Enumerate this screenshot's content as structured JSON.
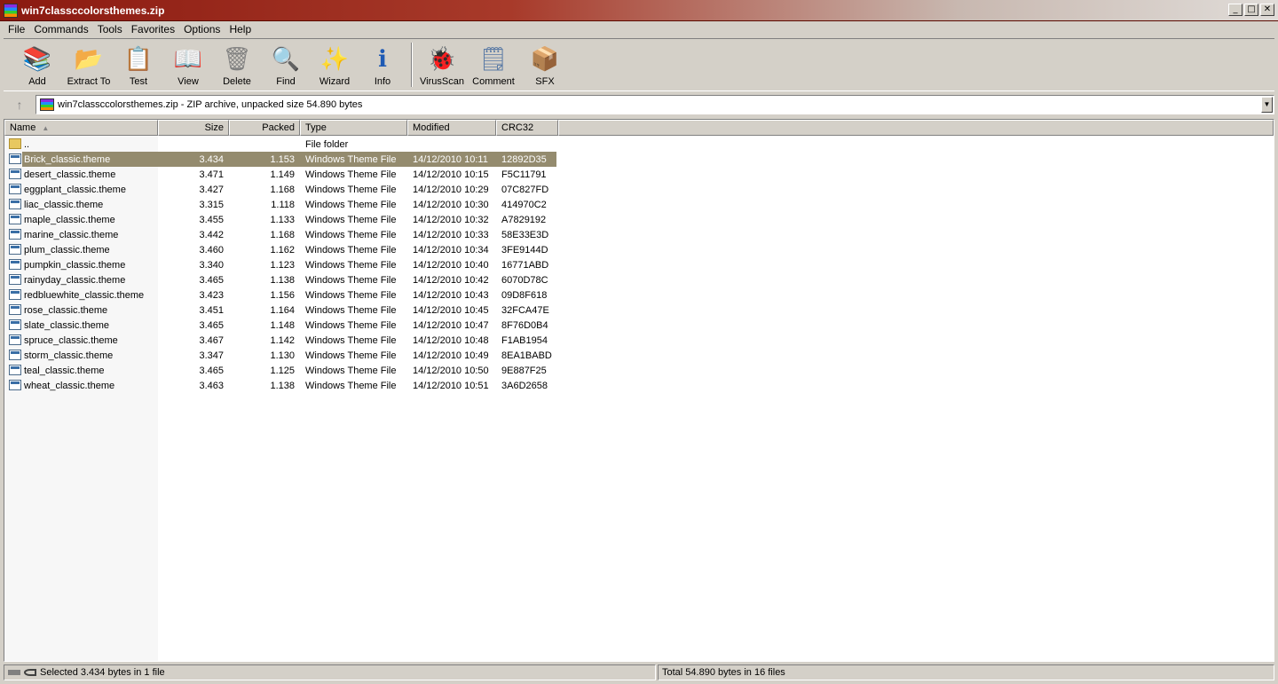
{
  "window": {
    "title": "win7classccolorsthemes.zip",
    "controls": {
      "minimize": "_",
      "maximize": "□",
      "close": "✕"
    }
  },
  "menu": [
    "File",
    "Commands",
    "Tools",
    "Favorites",
    "Options",
    "Help"
  ],
  "toolbar": {
    "buttons": [
      {
        "label": "Add",
        "icon": "add-archive-icon",
        "glyph": "📚",
        "color": "#8a2be2"
      },
      {
        "label": "Extract To",
        "icon": "extract-to-icon",
        "glyph": "📂",
        "color": "#1e90ff"
      },
      {
        "label": "Test",
        "icon": "test-icon",
        "glyph": "📋",
        "color": "#c0392b"
      },
      {
        "label": "View",
        "icon": "view-icon",
        "glyph": "📖",
        "color": "#2e8b57"
      },
      {
        "label": "Delete",
        "icon": "delete-icon",
        "glyph": "🗑",
        "color": "#808080"
      },
      {
        "label": "Find",
        "icon": "find-icon",
        "glyph": "🔍",
        "color": "#1e5ab4"
      },
      {
        "label": "Wizard",
        "icon": "wizard-icon",
        "glyph": "✨",
        "color": "#8a6d3b"
      },
      {
        "label": "Info",
        "icon": "info-icon",
        "glyph": "ℹ",
        "color": "#1e5ab4"
      },
      {
        "label": "VirusScan",
        "icon": "virus-scan-icon",
        "glyph": "🐞",
        "color": "#2eaa2e"
      },
      {
        "label": "Comment",
        "icon": "comment-icon",
        "glyph": "🗒",
        "color": "#5a7aa5"
      },
      {
        "label": "SFX",
        "icon": "sfx-icon",
        "glyph": "📦",
        "color": "#d2691e"
      }
    ]
  },
  "address": {
    "up_glyph": "↑",
    "text": "win7classccolorsthemes.zip - ZIP archive, unpacked size 54.890 bytes",
    "dropdown_glyph": "▼"
  },
  "columns": {
    "name": "Name",
    "sort_glyph": "▲",
    "size": "Size",
    "packed": "Packed",
    "type": "Type",
    "modified": "Modified",
    "crc": "CRC32"
  },
  "parent_row": {
    "name": "..",
    "type": "File folder"
  },
  "files": [
    {
      "name": "Brick_classic.theme",
      "size": "3.434",
      "packed": "1.153",
      "type": "Windows Theme File",
      "modified": "14/12/2010 10:11",
      "crc": "12892D35",
      "selected": true
    },
    {
      "name": "desert_classic.theme",
      "size": "3.471",
      "packed": "1.149",
      "type": "Windows Theme File",
      "modified": "14/12/2010 10:15",
      "crc": "F5C11791"
    },
    {
      "name": "eggplant_classic.theme",
      "size": "3.427",
      "packed": "1.168",
      "type": "Windows Theme File",
      "modified": "14/12/2010 10:29",
      "crc": "07C827FD"
    },
    {
      "name": "liac_classic.theme",
      "size": "3.315",
      "packed": "1.118",
      "type": "Windows Theme File",
      "modified": "14/12/2010 10:30",
      "crc": "414970C2"
    },
    {
      "name": "maple_classic.theme",
      "size": "3.455",
      "packed": "1.133",
      "type": "Windows Theme File",
      "modified": "14/12/2010 10:32",
      "crc": "A7829192"
    },
    {
      "name": "marine_classic.theme",
      "size": "3.442",
      "packed": "1.168",
      "type": "Windows Theme File",
      "modified": "14/12/2010 10:33",
      "crc": "58E33E3D"
    },
    {
      "name": "plum_classic.theme",
      "size": "3.460",
      "packed": "1.162",
      "type": "Windows Theme File",
      "modified": "14/12/2010 10:34",
      "crc": "3FE9144D"
    },
    {
      "name": "pumpkin_classic.theme",
      "size": "3.340",
      "packed": "1.123",
      "type": "Windows Theme File",
      "modified": "14/12/2010 10:40",
      "crc": "16771ABD"
    },
    {
      "name": "rainyday_classic.theme",
      "size": "3.465",
      "packed": "1.138",
      "type": "Windows Theme File",
      "modified": "14/12/2010 10:42",
      "crc": "6070D78C"
    },
    {
      "name": "redbluewhite_classic.theme",
      "size": "3.423",
      "packed": "1.156",
      "type": "Windows Theme File",
      "modified": "14/12/2010 10:43",
      "crc": "09D8F618"
    },
    {
      "name": "rose_classic.theme",
      "size": "3.451",
      "packed": "1.164",
      "type": "Windows Theme File",
      "modified": "14/12/2010 10:45",
      "crc": "32FCA47E"
    },
    {
      "name": "slate_classic.theme",
      "size": "3.465",
      "packed": "1.148",
      "type": "Windows Theme File",
      "modified": "14/12/2010 10:47",
      "crc": "8F76D0B4"
    },
    {
      "name": "spruce_classic.theme",
      "size": "3.467",
      "packed": "1.142",
      "type": "Windows Theme File",
      "modified": "14/12/2010 10:48",
      "crc": "F1AB1954"
    },
    {
      "name": "storm_classic.theme",
      "size": "3.347",
      "packed": "1.130",
      "type": "Windows Theme File",
      "modified": "14/12/2010 10:49",
      "crc": "8EA1BABD"
    },
    {
      "name": "teal_classic.theme",
      "size": "3.465",
      "packed": "1.125",
      "type": "Windows Theme File",
      "modified": "14/12/2010 10:50",
      "crc": "9E887F25"
    },
    {
      "name": "wheat_classic.theme",
      "size": "3.463",
      "packed": "1.138",
      "type": "Windows Theme File",
      "modified": "14/12/2010 10:51",
      "crc": "3A6D2658"
    }
  ],
  "status": {
    "selected": "Selected 3.434 bytes in 1 file",
    "total": "Total 54.890 bytes in 16 files"
  },
  "colors": {
    "selection": "#948b6e",
    "title_start": "#8b1a10",
    "chrome": "#d4d0c8"
  }
}
